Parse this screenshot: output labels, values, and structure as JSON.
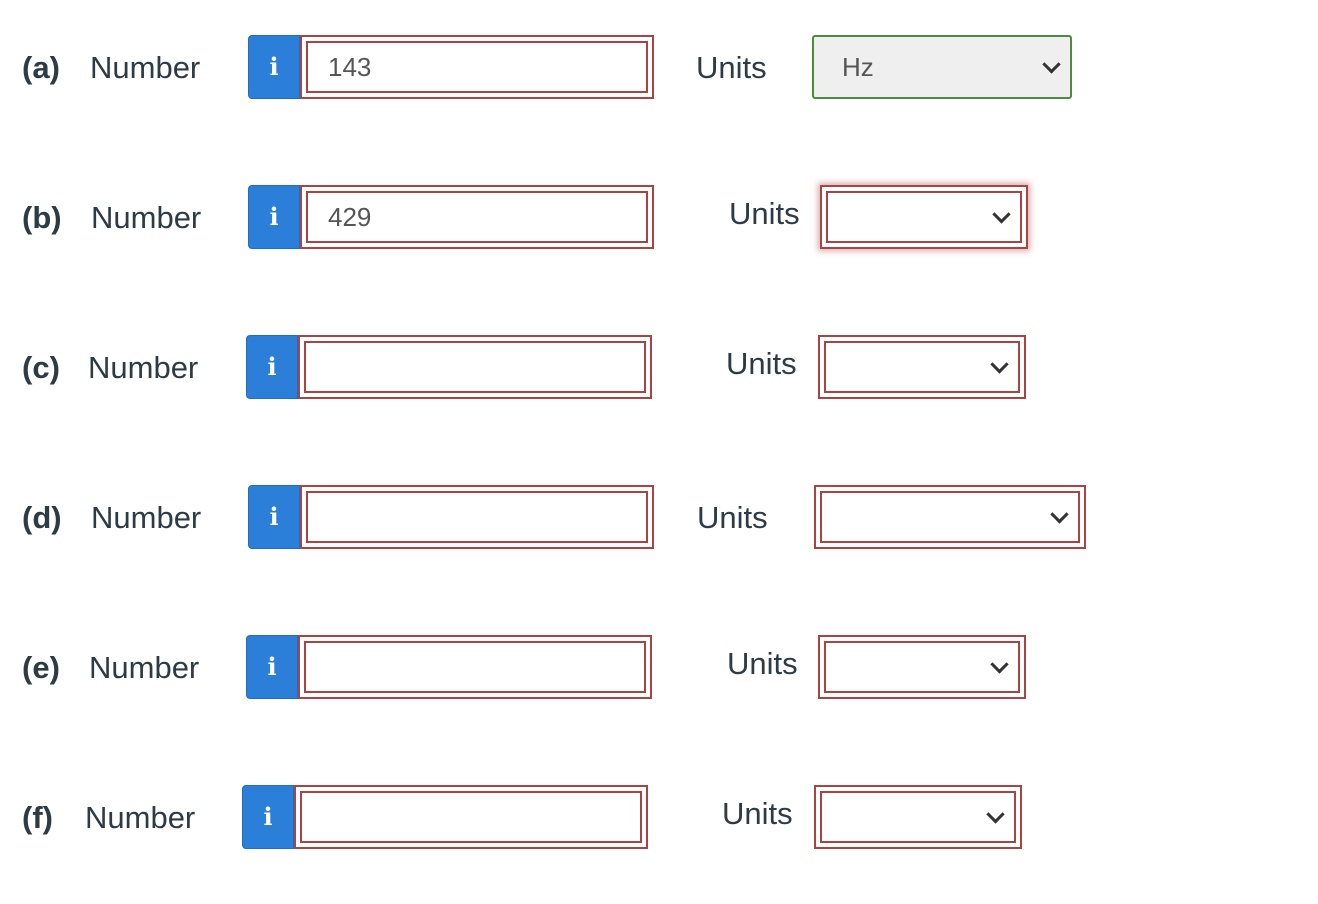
{
  "rows": [
    {
      "part": "(a)",
      "number_label": "Number",
      "info_icon": "i",
      "value": "143",
      "units_label": "Units",
      "units_selected": "Hz"
    },
    {
      "part": "(b)",
      "number_label": "Number",
      "info_icon": "i",
      "value": "429",
      "units_label": "Units",
      "units_selected": ""
    },
    {
      "part": "(c)",
      "number_label": "Number",
      "info_icon": "i",
      "value": "",
      "units_label": "Units",
      "units_selected": ""
    },
    {
      "part": "(d)",
      "number_label": "Number",
      "info_icon": "i",
      "value": "",
      "units_label": "Units",
      "units_selected": ""
    },
    {
      "part": "(e)",
      "number_label": "Number",
      "info_icon": "i",
      "value": "",
      "units_label": "Units",
      "units_selected": ""
    },
    {
      "part": "(f)",
      "number_label": "Number",
      "info_icon": "i",
      "value": "",
      "units_label": "Units",
      "units_selected": ""
    }
  ],
  "colors": {
    "info_button": "#2b7fd9",
    "error_border": "#a94442",
    "correct_border": "#4c8c3e",
    "text": "#2d3b45"
  },
  "icons": {
    "info": "info-icon",
    "dropdown": "chevron-down-icon"
  }
}
